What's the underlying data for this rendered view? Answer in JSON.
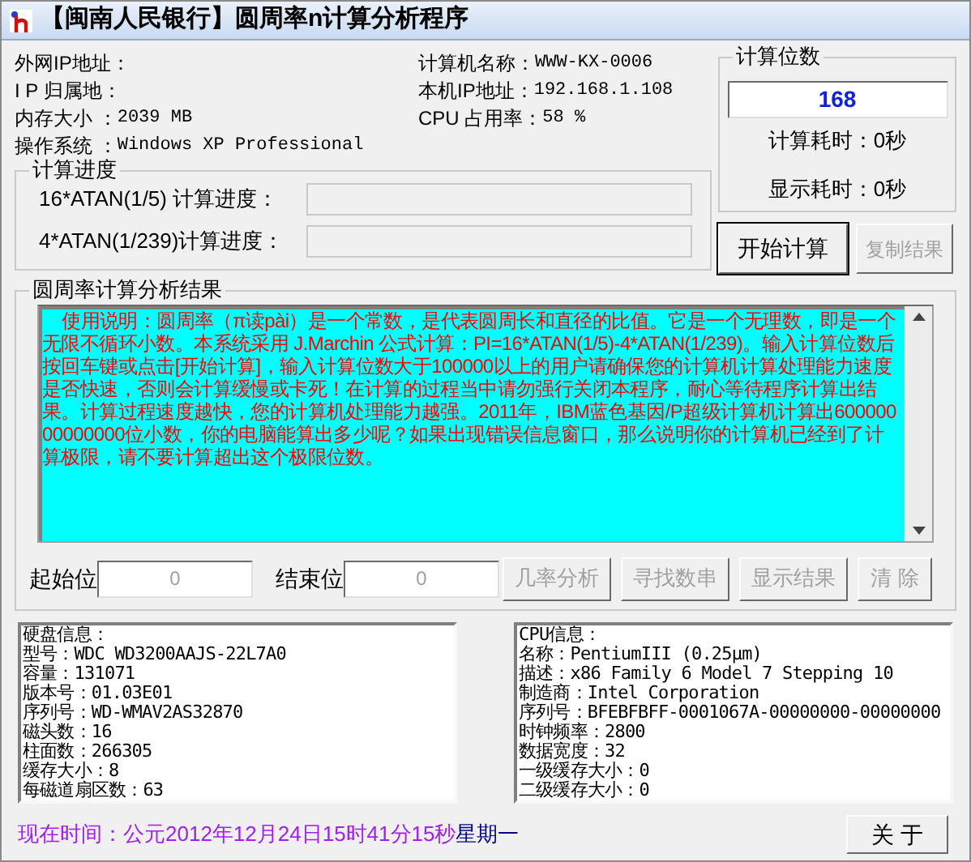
{
  "window": {
    "title": "【闽南人民银行】圆周率n计算分析程序"
  },
  "system_info": [
    {
      "label": "外网IP地址："
    },
    {
      "label": "I P 归属地："
    },
    {
      "label": "内存大小  ：",
      "value": "2039 MB"
    },
    {
      "label": "操作系统  ：",
      "value": "Windows XP Professional"
    }
  ],
  "machine_info": [
    {
      "label": "计算机名称：",
      "value": "WWW-KX-0006"
    },
    {
      "label": "本机IP地址：",
      "value": "192.168.1.108"
    },
    {
      "label": "CPU 占用率：",
      "value": "58 %"
    }
  ],
  "progress_group": {
    "title": "计算进度",
    "rows": [
      {
        "label": "16*ATAN(1/5) 计算进度：",
        "level": 0
      },
      {
        "label": "4*ATAN(1/239)计算进度：",
        "level": 0
      }
    ]
  },
  "digits_group": {
    "title": "计算位数",
    "value": "168",
    "calc_time": "计算耗时：0秒",
    "display_time": "显示耗时：0秒"
  },
  "top_buttons": [
    {
      "label": "开始计算",
      "disabled": false
    },
    {
      "label": "复制结果",
      "disabled": true
    }
  ],
  "result_group": {
    "title": "圆周率计算分析结果",
    "text": "    使用说明：圆周率（π读pài）是一个常数，是代表圆周长和直径的比值。它是一个无理数，即是一个无限不循环小数。本系统采用 J.Marchin 公式计算：PI=16*ATAN(1/5)-4*ATAN(1/239)。输入计算位数后按回车键或点击[开始计算]，输入计算位数大于100000以上的用户请确保您的计算机计算处理能力速度是否快速，否则会计算缓慢或卡死！在计算的过程当中请勿强行关闭本程序，耐心等待程序计算出结果。计算过程速度越快，您的计算机处理能力越强。2011年，IBM蓝色基因/P超级计算机计算出60000000000000位小数，你的电脑能算出多少呢？如果出现错误信息窗口，那么说明你的计算机已经到了计算极限，请不要计算超出这个极限位数。"
  },
  "range": {
    "start_label": "起始位",
    "start_value": "0",
    "end_label": "结束位",
    "end_value": "0"
  },
  "analysis_buttons": [
    {
      "label": "几率分析",
      "disabled": true
    },
    {
      "label": "寻找数串",
      "disabled": true
    },
    {
      "label": "显示结果",
      "disabled": true
    },
    {
      "label": "清 除",
      "disabled": true
    }
  ],
  "disk_info": [
    "硬盘信息：",
    "型号：WDC WD3200AAJS-22L7A0",
    "容量：131071",
    "版本号：01.03E01",
    "序列号：WD-WMAV2AS32870",
    "磁头数：16",
    "柱面数：266305",
    "缓存大小：8",
    "每磁道扇区数：63"
  ],
  "cpu_info": [
    "CPU信息：",
    "名称：PentiumIII (0.25μm)",
    "描述：x86 Family 6 Model 7 Stepping 10",
    "制造商：Intel Corporation",
    "序列号：BFEBFBFF-0001067A-00000000-00000000",
    "时钟频率：2800",
    "数据宽度：32",
    "一级缓存大小：0",
    "二级缓存大小：0"
  ],
  "status": {
    "time": "现在时间：公元2012年12月24日15时41分15秒",
    "weekday": "星期一"
  },
  "about_button": {
    "label": "关 于"
  }
}
